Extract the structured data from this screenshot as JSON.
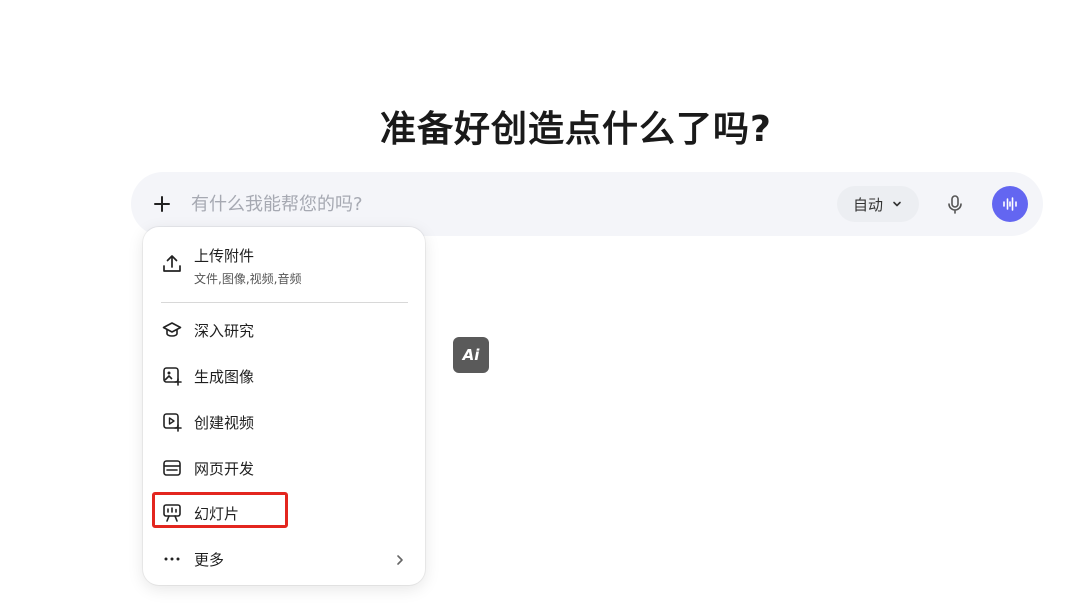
{
  "heading": "准备好创造点什么了吗?",
  "chat": {
    "placeholder": "有什么我能帮您的吗?",
    "mode_label": "自动",
    "plus_icon": "plus-icon",
    "mic_icon": "microphone-icon",
    "voice_icon": "voice-wave-icon",
    "accent_color": "#6366f1"
  },
  "menu": {
    "upload": {
      "label": "上传附件",
      "subtitle": "文件,图像,视频,音频",
      "icon": "upload-icon"
    },
    "items": [
      {
        "label": "深入研究",
        "icon": "graduation-cap-icon"
      },
      {
        "label": "生成图像",
        "icon": "image-plus-icon"
      },
      {
        "label": "创建视频",
        "icon": "video-plus-icon"
      },
      {
        "label": "网页开发",
        "icon": "browser-window-icon"
      },
      {
        "label": "幻灯片",
        "icon": "presentation-icon"
      },
      {
        "label": "更多",
        "icon": "more-dots-icon"
      }
    ],
    "highlight_color": "#e3261f"
  },
  "ai_badge": {
    "label": "Ai"
  }
}
